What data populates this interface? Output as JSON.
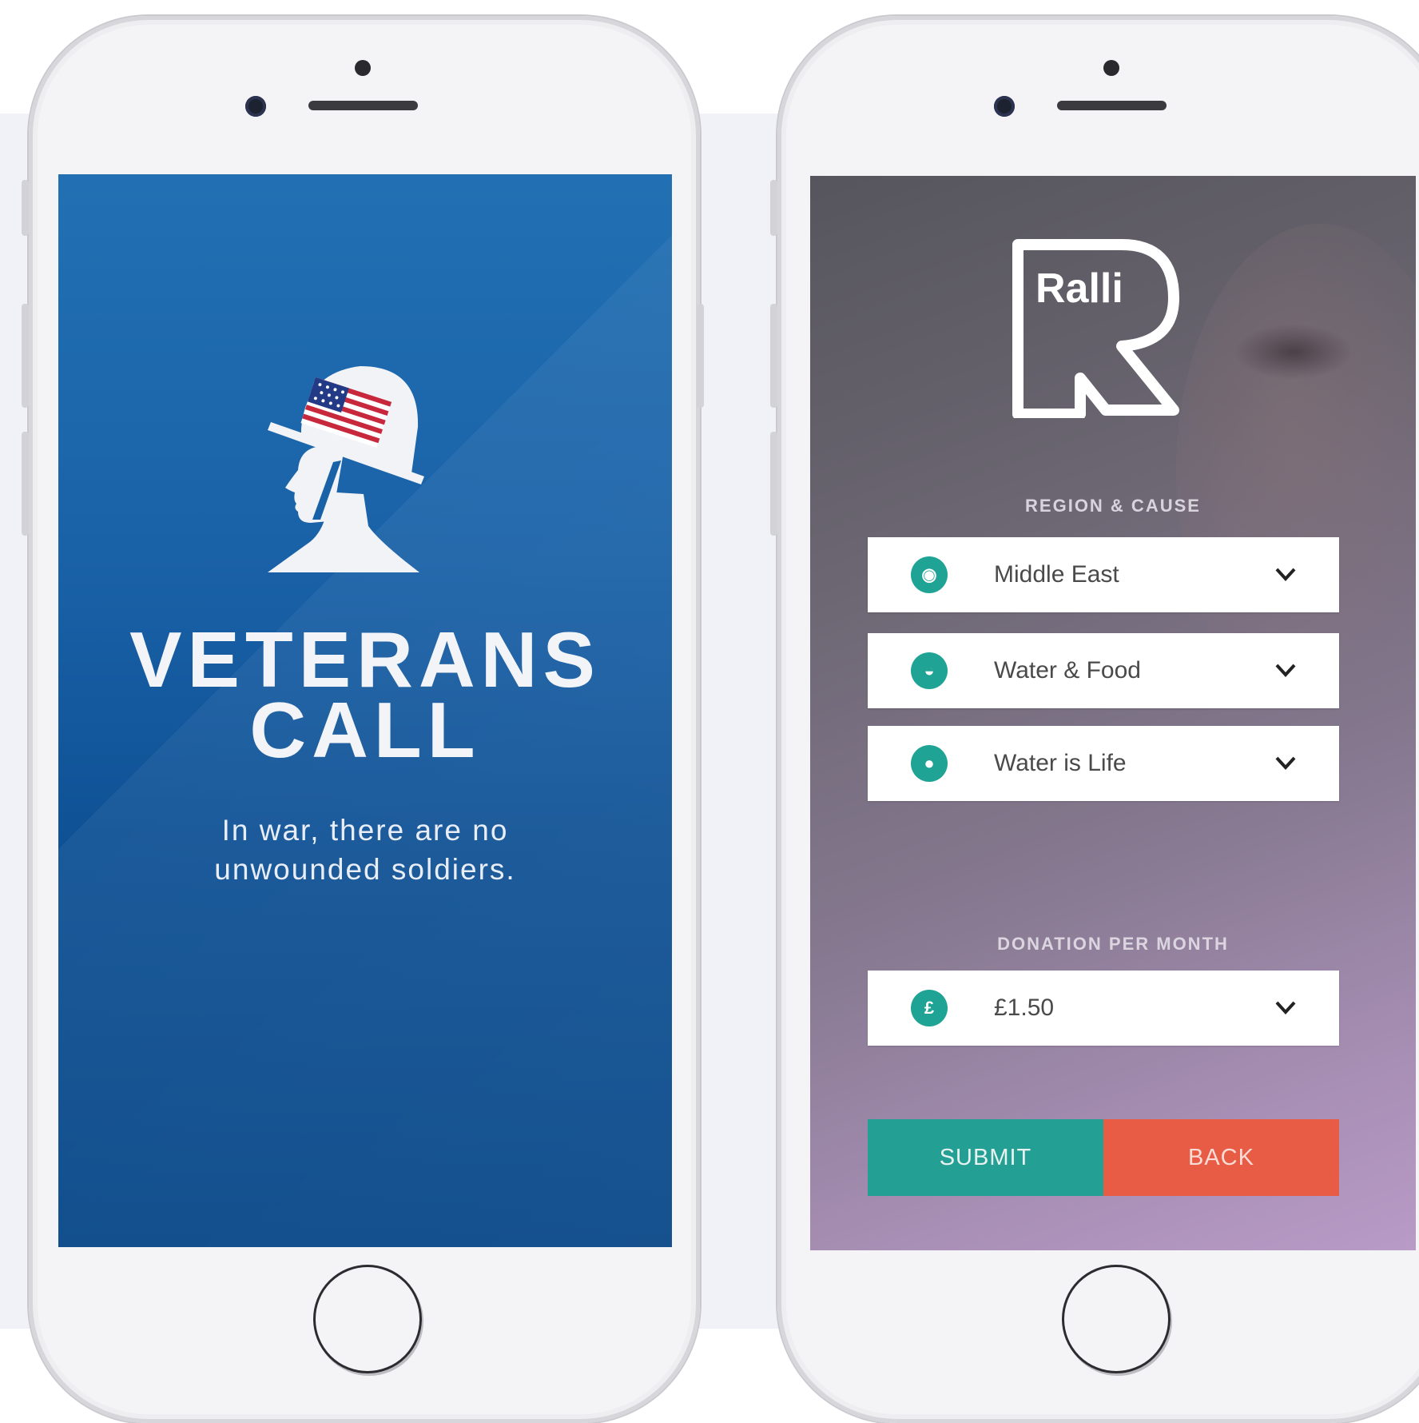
{
  "veterans_call": {
    "title_line1": "VETERANS",
    "title_line2": "CALL",
    "tagline_line1": "In war, there are no",
    "tagline_line2": "unwounded soldiers."
  },
  "ralli": {
    "logo_text": "Ralli",
    "region_label": "REGION & CAUSE",
    "selects": [
      {
        "value": "Middle East",
        "icon": "globe-icon"
      },
      {
        "value": "Water & Food",
        "icon": "bowl-icon"
      },
      {
        "value": "Water is Life",
        "icon": "water-drop-icon"
      }
    ],
    "donation_label": "DONATION PER MONTH",
    "donation": {
      "value": "£1.50",
      "icon_glyph": "£",
      "icon": "pound-icon"
    },
    "submit_label": "SUBMIT",
    "back_label": "BACK"
  },
  "colors": {
    "veterans_blue": "#1a62a8",
    "ralli_teal": "#23a093",
    "ralli_red": "#e85c46"
  }
}
